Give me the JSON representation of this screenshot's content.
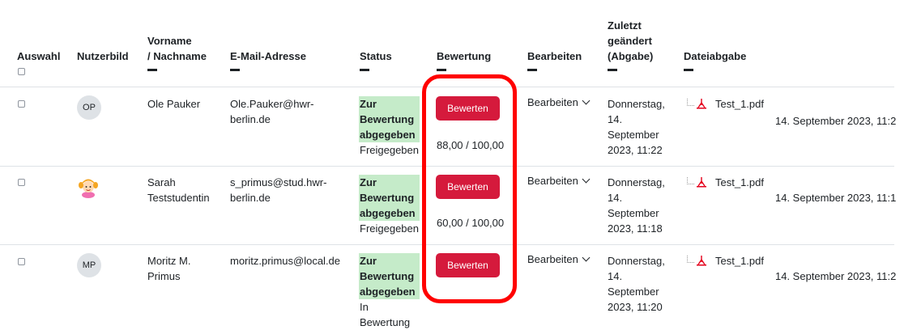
{
  "headers": {
    "select": "Auswahl",
    "picture": "Nutzerbild",
    "name_line1": "Vorname",
    "name_line2": "/ Nachname",
    "email": "E-Mail-Adresse",
    "status": "Status",
    "grade": "Bewertung",
    "edit": "Bearbeiten",
    "modified_line1": "Zuletzt",
    "modified_line2": "geändert",
    "modified_line3": "(Abgabe)",
    "file": "Dateiabgabe"
  },
  "rows": [
    {
      "initials": "OP",
      "name_line1": "Ole Pauker",
      "name_line2": "",
      "email_line1": "Ole.Pauker@hwr-",
      "email_line2": "berlin.de",
      "status_line1": "Zur",
      "status_line2": "Bewertung",
      "status_line3": "abgegeben",
      "status_sub1": "Freigegeben",
      "status_sub2": "",
      "button": "Bewerten",
      "grade": "88,00 / 100,00",
      "edit": "Bearbeiten",
      "mod_line1": "Donnerstag,",
      "mod_line2": "14.",
      "mod_line3": "September",
      "mod_line4": "2023, 11:22",
      "file": "Test_1.pdf",
      "file_date": "14. September 2023, 11:2"
    },
    {
      "initials": "",
      "name_line1": "Sarah",
      "name_line2": "Teststudentin",
      "email_line1": "s_primus@stud.hwr-",
      "email_line2": "berlin.de",
      "status_line1": "Zur",
      "status_line2": "Bewertung",
      "status_line3": "abgegeben",
      "status_sub1": "Freigegeben",
      "status_sub2": "",
      "button": "Bewerten",
      "grade": "60,00 / 100,00",
      "edit": "Bearbeiten",
      "mod_line1": "Donnerstag,",
      "mod_line2": "14.",
      "mod_line3": "September",
      "mod_line4": "2023, 11:18",
      "file": "Test_1.pdf",
      "file_date": "14. September 2023, 11:1"
    },
    {
      "initials": "MP",
      "name_line1": "Moritz M.",
      "name_line2": "Primus",
      "email_line1": "moritz.primus@local.de",
      "email_line2": "",
      "status_line1": "Zur",
      "status_line2": "Bewertung",
      "status_line3": "abgegeben",
      "status_sub1": "In",
      "status_sub2": "Bewertung",
      "button": "Bewerten",
      "grade": "",
      "edit": "Bearbeiten",
      "mod_line1": "Donnerstag,",
      "mod_line2": "14.",
      "mod_line3": "September",
      "mod_line4": "2023, 11:20",
      "file": "Test_1.pdf",
      "file_date": "14. September 2023, 11:2"
    }
  ],
  "colors": {
    "button": "#d51a3c",
    "status_highlight": "#c5ebc9",
    "annotation": "#ff0000"
  }
}
